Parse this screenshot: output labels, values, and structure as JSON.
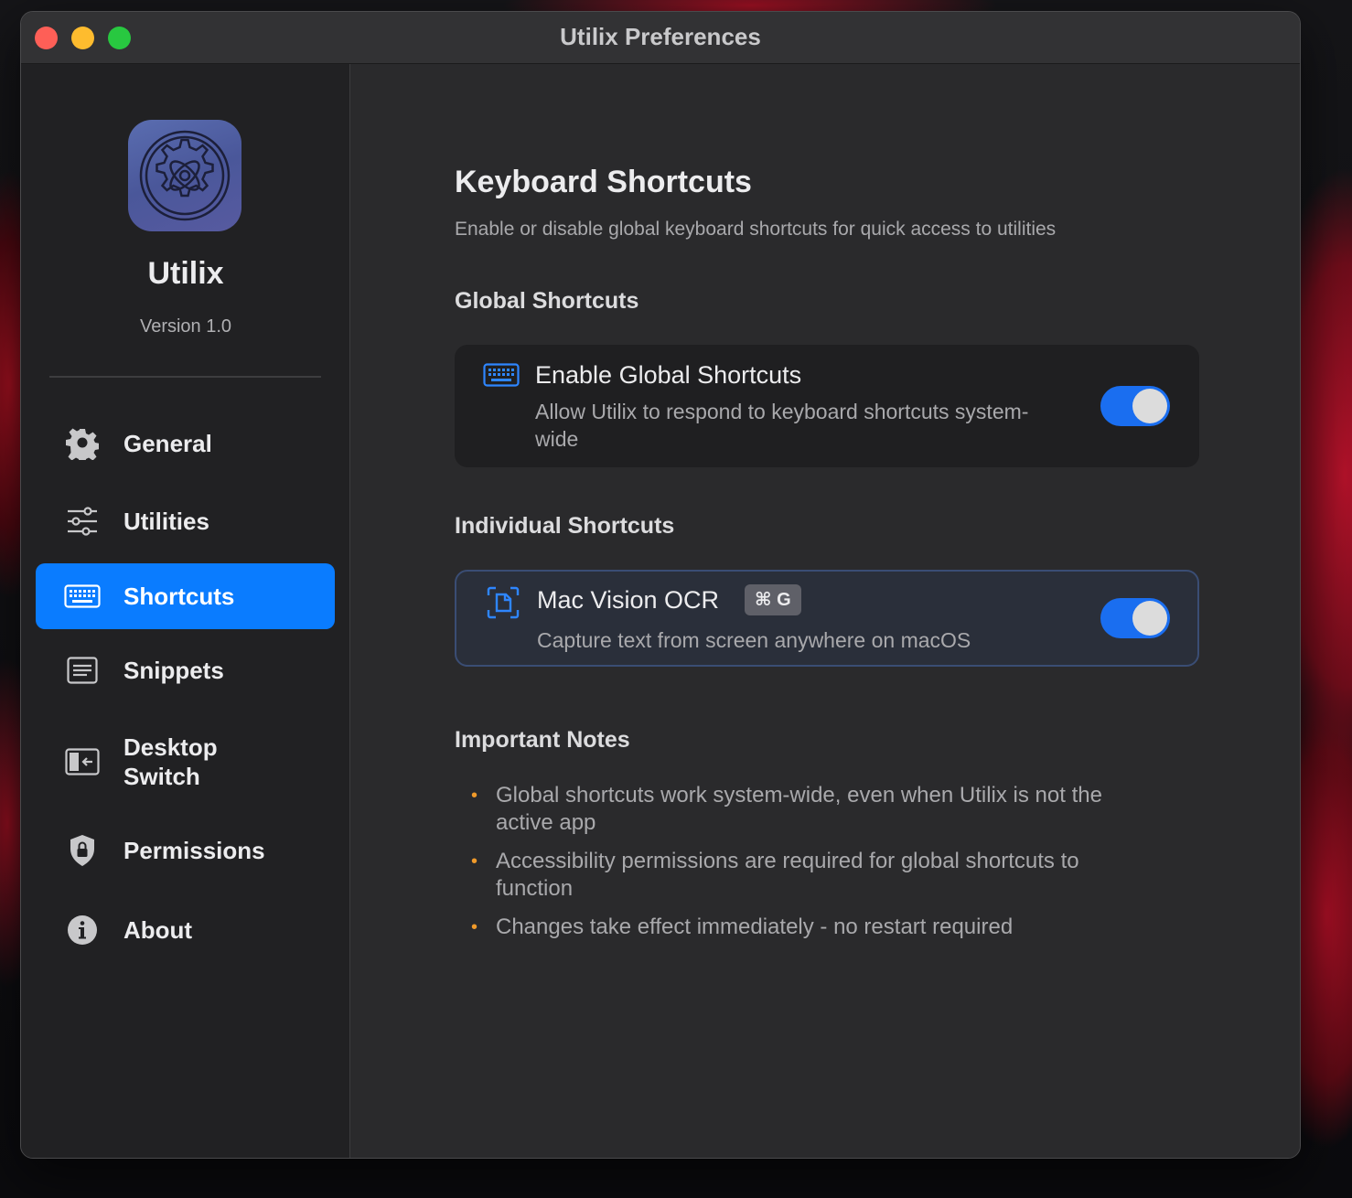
{
  "window": {
    "title": "Utilix Preferences"
  },
  "sidebar": {
    "app_name": "Utilix",
    "version": "Version 1.0",
    "items": [
      {
        "label": "General",
        "icon": "gear-icon"
      },
      {
        "label": "Utilities",
        "icon": "sliders-icon"
      },
      {
        "label": "Shortcuts",
        "icon": "keyboard-icon",
        "active": true
      },
      {
        "label": "Snippets",
        "icon": "snippet-icon"
      },
      {
        "label": "Desktop\nSwitch",
        "icon": "desktop-switch-icon"
      },
      {
        "label": "Permissions",
        "icon": "shield-lock-icon"
      },
      {
        "label": "About",
        "icon": "info-icon"
      }
    ]
  },
  "main": {
    "title": "Keyboard Shortcuts",
    "subtitle": "Enable or disable global keyboard shortcuts for quick access to utilities",
    "global_section": {
      "heading": "Global Shortcuts",
      "card": {
        "icon": "keyboard-icon",
        "title": "Enable Global Shortcuts",
        "description": "Allow Utilix to respond to keyboard shortcuts system-wide",
        "enabled": true
      }
    },
    "individual_section": {
      "heading": "Individual Shortcuts",
      "card": {
        "icon": "ocr-scan-icon",
        "title": "Mac Vision OCR",
        "shortcut": "⌘ G",
        "description": "Capture text from screen anywhere on macOS",
        "enabled": true
      }
    },
    "notes_section": {
      "heading": "Important Notes",
      "bullet": "•",
      "notes": [
        "Global shortcuts work system-wide, even when Utilix is not the active app",
        "Accessibility permissions are required for global shortcuts to function",
        "Changes take effect immediately - no restart required"
      ]
    }
  },
  "colors": {
    "accent": "#0a7cff",
    "toggle_on": "#1a6ef0",
    "bullet": "#f09a2a"
  }
}
